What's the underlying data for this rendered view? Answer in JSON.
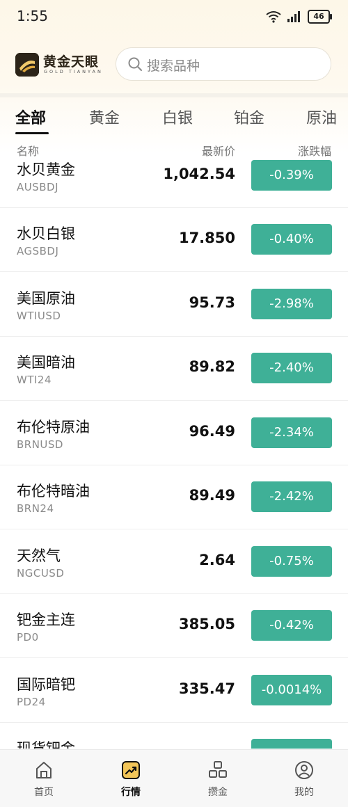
{
  "status_bar": {
    "time": "1:55",
    "battery": "46"
  },
  "header": {
    "brand_cn": "黄金天眼",
    "brand_en": "GOLD TIANYAN",
    "search_placeholder": "搜索品种"
  },
  "tabs": [
    {
      "label": "全部",
      "active": true
    },
    {
      "label": "黄金"
    },
    {
      "label": "白银"
    },
    {
      "label": "铂金"
    },
    {
      "label": "原油"
    }
  ],
  "columns": {
    "name": "名称",
    "price": "最新价",
    "change": "涨跌幅"
  },
  "rows": [
    {
      "name": "水贝黄金",
      "code": "AUSBDJ",
      "price": "1,042.54",
      "change": "-0.39%"
    },
    {
      "name": "水贝白银",
      "code": "AGSBDJ",
      "price": "17.850",
      "change": "-0.40%"
    },
    {
      "name": "美国原油",
      "code": "WTIUSD",
      "price": "95.73",
      "change": "-2.98%"
    },
    {
      "name": "美国暗油",
      "code": "WTI24",
      "price": "89.82",
      "change": "-2.40%"
    },
    {
      "name": "布伦特原油",
      "code": "BRNUSD",
      "price": "96.49",
      "change": "-2.34%"
    },
    {
      "name": "布伦特暗油",
      "code": "BRN24",
      "price": "89.49",
      "change": "-2.42%"
    },
    {
      "name": "天然气",
      "code": "NGCUSD",
      "price": "2.64",
      "change": "-0.75%"
    },
    {
      "name": "钯金主连",
      "code": "PD0",
      "price": "385.05",
      "change": "-0.42%"
    },
    {
      "name": "国际暗钯",
      "code": "PD24",
      "price": "335.47",
      "change": "-0.0014%"
    },
    {
      "name": "现货钯金",
      "code": "",
      "price": "",
      "change": ""
    }
  ],
  "bottom_nav": [
    {
      "label": "首页",
      "icon": "home-icon"
    },
    {
      "label": "行情",
      "icon": "market-chart-icon",
      "active": true
    },
    {
      "label": "攒金",
      "icon": "gold-bars-icon"
    },
    {
      "label": "我的",
      "icon": "profile-icon"
    }
  ],
  "colors": {
    "change_badge": "#3fb097",
    "header_bg": "#fdf7e8",
    "logo_bg": "#2c2418"
  }
}
